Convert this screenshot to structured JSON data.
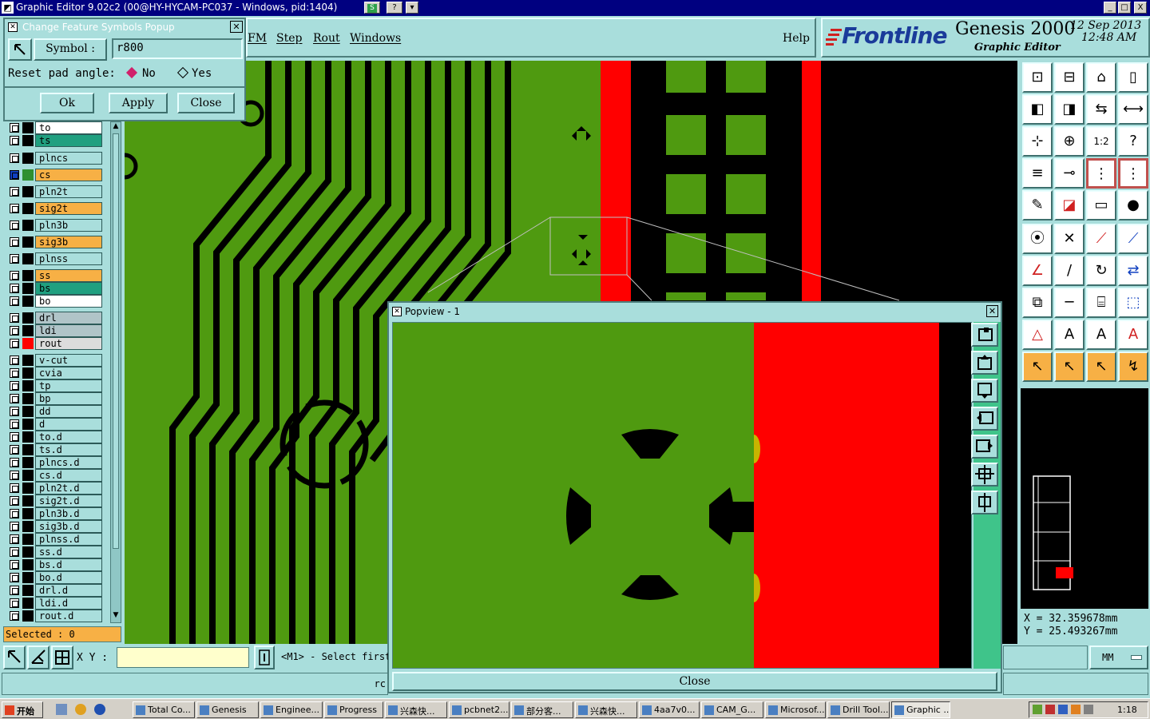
{
  "window": {
    "title": "Graphic Editor 9.02c2 (00@HY-HYCAM-PC037 - Windows, pid:1404)",
    "help_button": "?",
    "min_button": "_",
    "max_button": "□",
    "close_button": "X"
  },
  "menubar": {
    "items": [
      "FM",
      "Step",
      "Rout",
      "Windows"
    ],
    "help": "Help"
  },
  "logo": {
    "brand": "Frontline",
    "product": "Genesis 2000",
    "subtitle": "Graphic Editor",
    "date": "12  Sep  2013",
    "time": "12:48  AM"
  },
  "popup": {
    "title": "Change Feature Symbols Popup",
    "symbol_label": "Symbol  :",
    "symbol_value": "r800",
    "reset_label": "Reset pad angle:",
    "option_no": "No",
    "option_yes": "Yes",
    "selected_option": "No",
    "ok": "Ok",
    "apply": "Apply",
    "close": "Close"
  },
  "layers": [
    {
      "name": "to",
      "color": "#ffffff",
      "swatch": "#000000"
    },
    {
      "name": "ts",
      "color": "#20a080",
      "swatch": "#000000"
    },
    {
      "name": "plncs",
      "color": "#a9dedc",
      "swatch": "#000000"
    },
    {
      "name": "cs",
      "color": "#f7b045",
      "swatch": "#2f8f2f",
      "active": true
    },
    {
      "name": "pln2t",
      "color": "#a9dedc",
      "swatch": "#000000"
    },
    {
      "name": "sig2t",
      "color": "#f7b045",
      "swatch": "#000000"
    },
    {
      "name": "pln3b",
      "color": "#a9dedc",
      "swatch": "#000000"
    },
    {
      "name": "sig3b",
      "color": "#f7b045",
      "swatch": "#000000"
    },
    {
      "name": "plnss",
      "color": "#a9dedc",
      "swatch": "#000000"
    },
    {
      "name": "ss",
      "color": "#f7b045",
      "swatch": "#000000"
    },
    {
      "name": "bs",
      "color": "#20a080",
      "swatch": "#000000"
    },
    {
      "name": "bo",
      "color": "#ffffff",
      "swatch": "#000000"
    },
    {
      "name": "drl",
      "color": "#b0c4c8",
      "swatch": "#000000"
    },
    {
      "name": "ldi",
      "color": "#b0c4c8",
      "swatch": "#000000"
    },
    {
      "name": "rout",
      "color": "#dcdcdc",
      "swatch": "#ff0000"
    },
    {
      "name": "v-cut",
      "color": "#a9dedc",
      "swatch": "#000000"
    },
    {
      "name": "cvia",
      "color": "#a9dedc",
      "swatch": "#000000"
    },
    {
      "name": "tp",
      "color": "#a9dedc",
      "swatch": "#000000"
    },
    {
      "name": "bp",
      "color": "#a9dedc",
      "swatch": "#000000"
    },
    {
      "name": "dd",
      "color": "#a9dedc",
      "swatch": "#000000"
    },
    {
      "name": "d",
      "color": "#a9dedc",
      "swatch": "#000000"
    },
    {
      "name": "to.d",
      "color": "#a9dedc",
      "swatch": "#000000"
    },
    {
      "name": "ts.d",
      "color": "#a9dedc",
      "swatch": "#000000"
    },
    {
      "name": "plncs.d",
      "color": "#a9dedc",
      "swatch": "#000000"
    },
    {
      "name": "cs.d",
      "color": "#a9dedc",
      "swatch": "#000000"
    },
    {
      "name": "pln2t.d",
      "color": "#a9dedc",
      "swatch": "#000000"
    },
    {
      "name": "sig2t.d",
      "color": "#a9dedc",
      "swatch": "#000000"
    },
    {
      "name": "pln3b.d",
      "color": "#a9dedc",
      "swatch": "#000000"
    },
    {
      "name": "sig3b.d",
      "color": "#a9dedc",
      "swatch": "#000000"
    },
    {
      "name": "plnss.d",
      "color": "#a9dedc",
      "swatch": "#000000"
    },
    {
      "name": "ss.d",
      "color": "#a9dedc",
      "swatch": "#000000"
    },
    {
      "name": "bs.d",
      "color": "#a9dedc",
      "swatch": "#000000"
    },
    {
      "name": "bo.d",
      "color": "#a9dedc",
      "swatch": "#000000"
    },
    {
      "name": "drl.d",
      "color": "#a9dedc",
      "swatch": "#000000"
    },
    {
      "name": "ldi.d",
      "color": "#a9dedc",
      "swatch": "#000000"
    },
    {
      "name": "rout.d",
      "color": "#a9dedc",
      "swatch": "#000000"
    }
  ],
  "status": {
    "selected": "Selected : 0",
    "xy_label": "X Y :",
    "xy_value": "",
    "prompt": "<M1> - Select first",
    "bottom_text": "rc",
    "units": "MM"
  },
  "coords": {
    "x": "X  =  32.359678mm",
    "y": "Y  =  25.493267mm"
  },
  "popview": {
    "title": "Popview - 1",
    "close": "Close"
  },
  "taskbar": {
    "start": "开始",
    "clock": "1:18",
    "tasks": [
      "Total Co...",
      "Genesis",
      "Enginee...",
      "Progress",
      "兴森快...",
      "pcbnet2...",
      "部分客...",
      "兴森快...",
      "4aa7v0...",
      "CAM_G...",
      "Microsof...",
      "Drill Tool...",
      "Graphic ..."
    ]
  },
  "colors": {
    "board": "#4f9a10",
    "rout": "#ff0000",
    "background": "#000000",
    "panel": "#a9dedc"
  }
}
